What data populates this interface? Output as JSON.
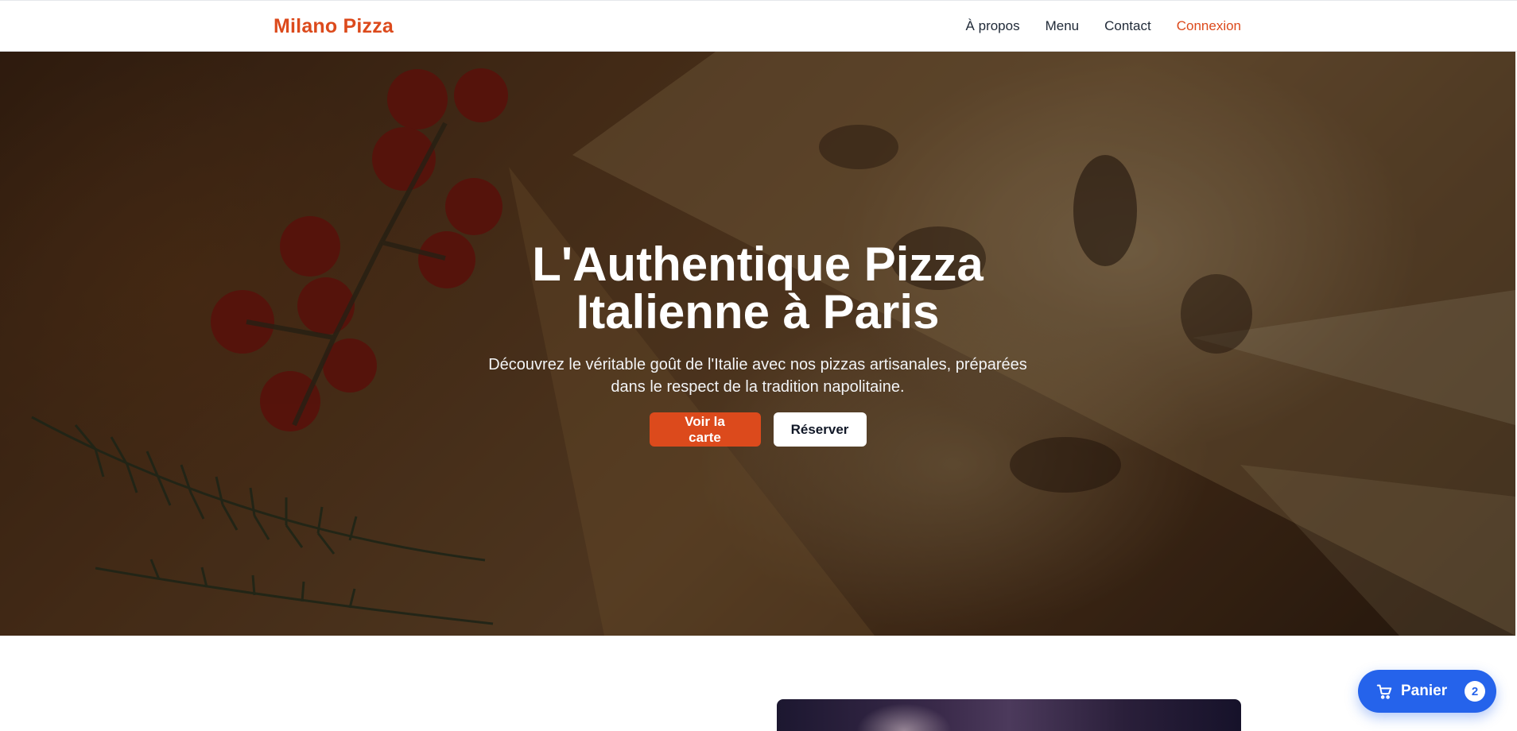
{
  "header": {
    "brand": "Milano Pizza",
    "nav": [
      "À propos",
      "Menu",
      "Contact",
      "Connexion"
    ]
  },
  "hero": {
    "title": "L'Authentique Pizza Italienne à Paris",
    "subtitle": "Découvrez le véritable goût de l'Italie avec nos pizzas artisanales, préparées dans le respect de la tradition napolitaine.",
    "primary_button": "Voir la carte",
    "secondary_button": "Réserver"
  },
  "cart": {
    "label": "Panier",
    "count": "2"
  },
  "colors": {
    "brand": "#dc4a1c",
    "cart": "#2563eb"
  }
}
